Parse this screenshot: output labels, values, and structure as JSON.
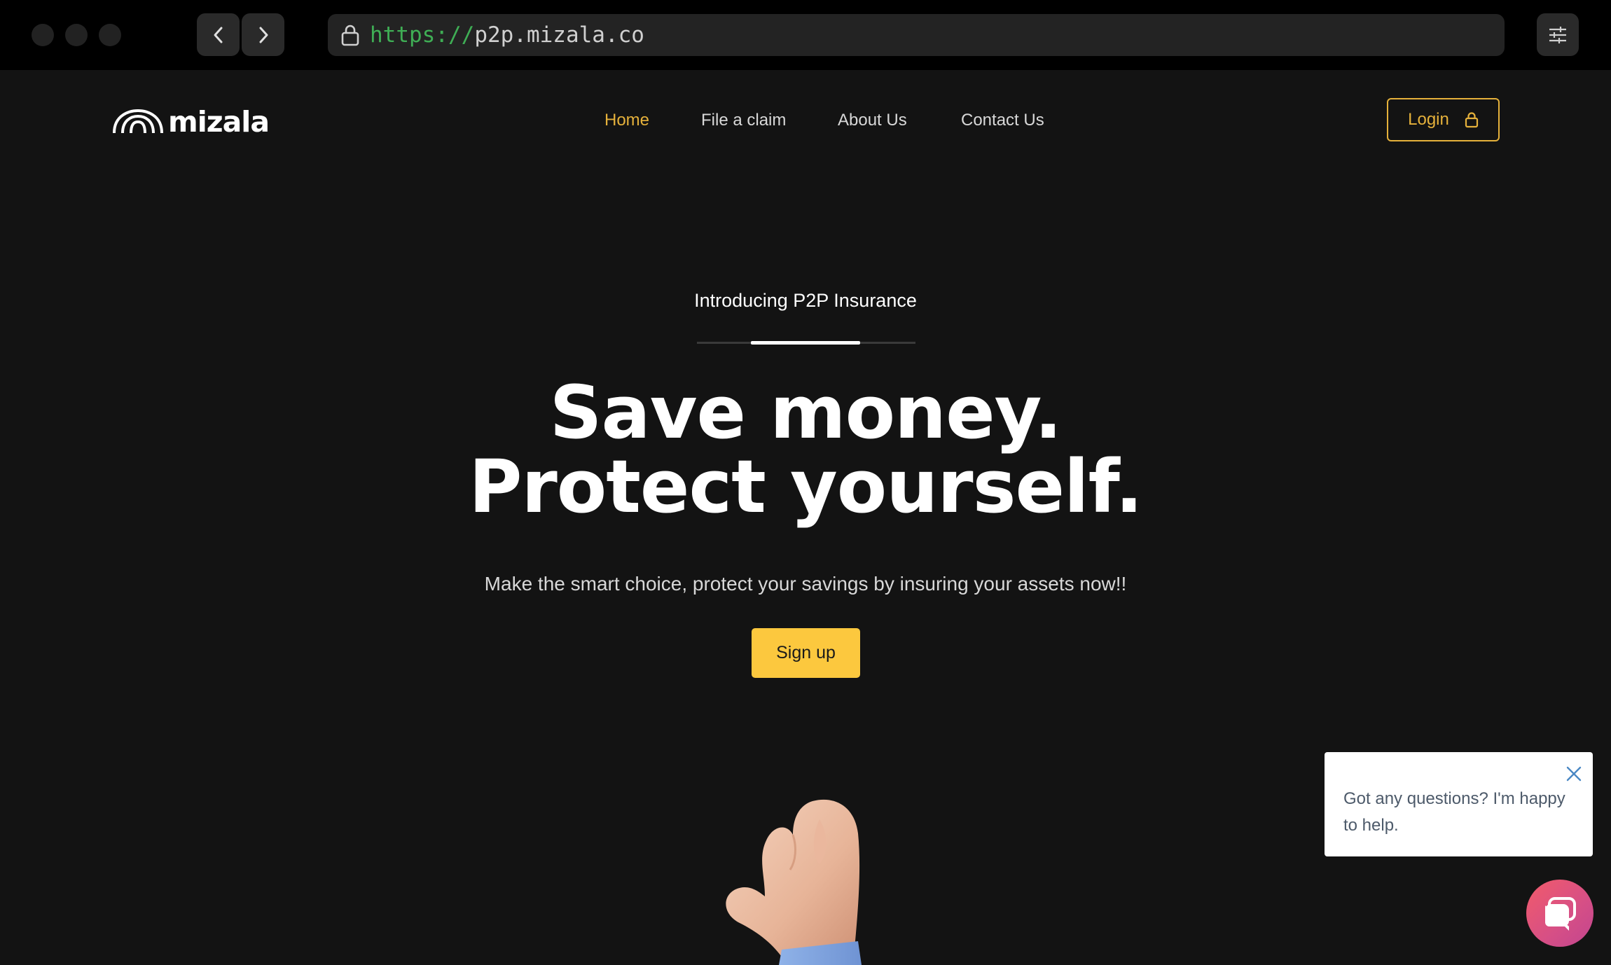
{
  "browser": {
    "url_scheme": "https://",
    "url_host": "p2p.mizala.co"
  },
  "site": {
    "logo_text": "mizala",
    "nav": [
      "Home",
      "File a claim",
      "About Us",
      "Contact Us"
    ],
    "active_nav": "Home",
    "login_label": "Login"
  },
  "hero": {
    "eyebrow": "Introducing P2P Insurance",
    "headline_line1": "Save money.",
    "headline_line2": "Protect yourself.",
    "subtitle": "Make the smart choice, protect your savings by insuring your assets now!!",
    "cta_label": "Sign up"
  },
  "chat": {
    "message": "Got any questions? I'm happy to help."
  },
  "colors": {
    "background": "#131313",
    "accent": "#e5b13b",
    "cta": "#fcc83e",
    "url_scheme": "#3fae55"
  }
}
